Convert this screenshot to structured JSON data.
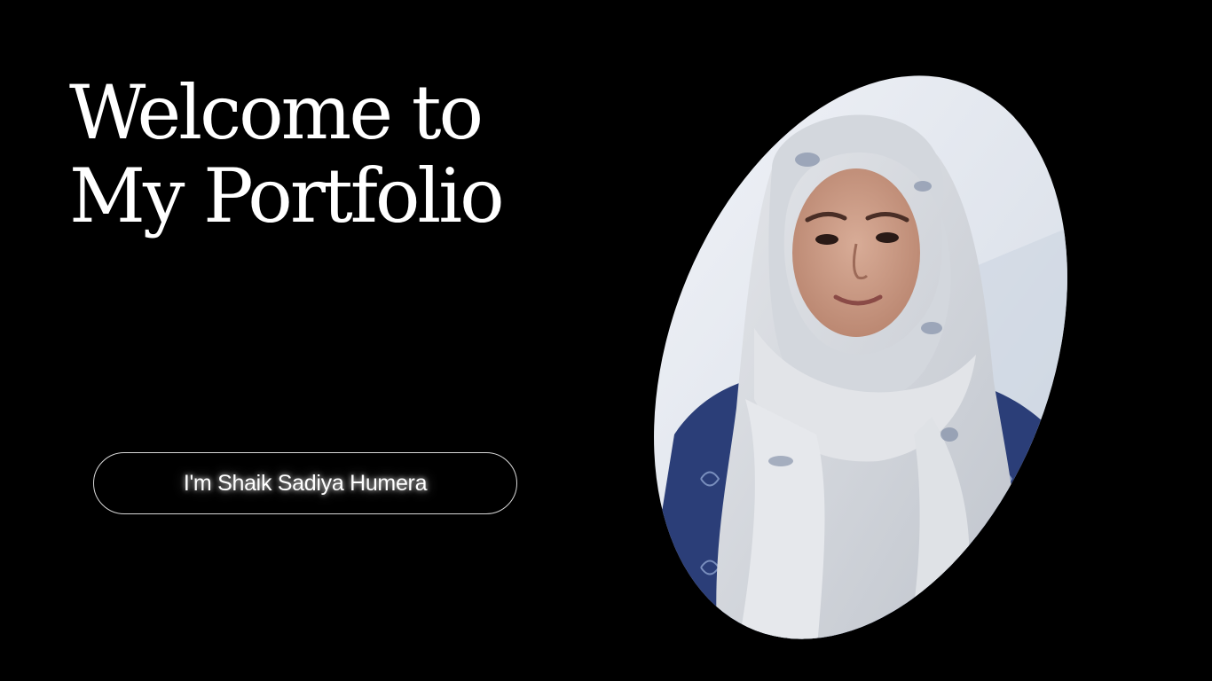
{
  "hero": {
    "title_line_1": "Welcome to",
    "title_line_2": "My Portfolio"
  },
  "intro": {
    "name_label": "I'm Shaik Sadiya Humera"
  },
  "portrait": {
    "icon": "person-portrait",
    "colors": {
      "background": "#000000",
      "wall": "#e6eaf1",
      "scarf": "#d7dade",
      "dress": "#2b3e78",
      "skin": "#c89a86"
    }
  }
}
